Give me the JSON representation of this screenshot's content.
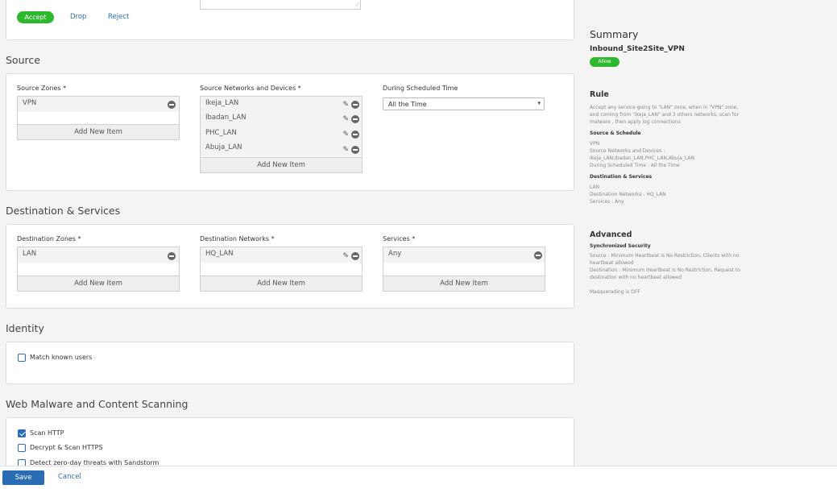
{
  "top_actions": {
    "accept": "Accept",
    "drop": "Drop",
    "reject": "Reject"
  },
  "source": {
    "title": "Source",
    "zones_label": "Source Zones *",
    "zones": [
      "VPN"
    ],
    "networks_label": "Source Networks and Devices *",
    "networks": [
      "Ikeja_LAN",
      "Ibadan_LAN",
      "PHC_LAN",
      "Abuja_LAN"
    ],
    "schedule_label": "During Scheduled Time",
    "schedule_value": "All the Time",
    "add_new": "Add New Item"
  },
  "destination": {
    "title": "Destination & Services",
    "zones_label": "Destination Zones *",
    "zones": [
      "LAN"
    ],
    "networks_label": "Destination Networks *",
    "networks": [
      "HQ_LAN"
    ],
    "services_label": "Services *",
    "services": [
      "Any"
    ],
    "add_new": "Add New Item"
  },
  "identity": {
    "title": "Identity",
    "match_known_users": "Match known users",
    "match_known_users_checked": false
  },
  "web_malware": {
    "title": "Web Malware and Content Scanning",
    "options": [
      {
        "label": "Scan HTTP",
        "checked": true
      },
      {
        "label": "Decrypt & Scan HTTPS",
        "checked": false
      },
      {
        "label": "Detect zero-day threats with Sandstorm",
        "checked": false
      }
    ]
  },
  "summary": {
    "title": "Summary",
    "rule_name": "Inbound_Site2Site_VPN",
    "badge": "Allow",
    "rule_heading": "Rule",
    "rule_text": "Accept any service going to \"LAN\" zone, when in \"VPN\" zone, and coming from \"Ikeja_LAN\" and 3 others networks, scan for malware , then apply log connections",
    "source_schedule_heading": "Source & Schedule",
    "source_lines": [
      "VPN",
      "Source Networks and Devices :",
      "Ikeja_LAN,Ibadan_LAN,PHC_LAN,Abuja_LAN",
      "During Scheduled Time : All the Time"
    ],
    "dest_heading": "Destination & Services",
    "dest_lines": [
      "LAN",
      "Destination Networks : HQ_LAN",
      "Services : Any"
    ],
    "advanced_heading": "Advanced",
    "sync_heading": "Synchronized Security",
    "sync_source": "Source : Minimum Heartbeat is No Restriction, Clients with no heartbeat allowed",
    "sync_dest": "Destination : Minimum Heartbeat is No Restriction, Request to destination with no heartbeat allowed",
    "masquerading": "Masquerading is OFF"
  },
  "footer": {
    "save": "Save",
    "cancel": "Cancel"
  },
  "colors": {
    "accent": "#2a6db5",
    "allow_green": "#2eb82e"
  }
}
